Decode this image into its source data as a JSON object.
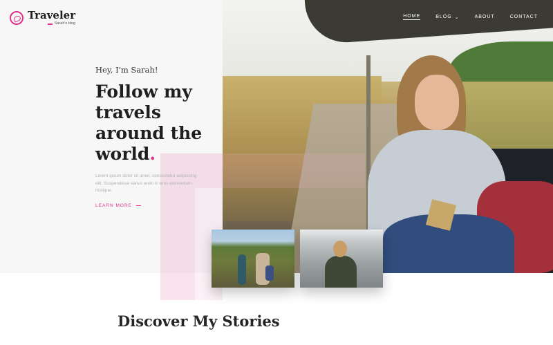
{
  "brand": {
    "title": "Traveler",
    "tagline": "Sarah's blog",
    "accent_color": "#e0318a",
    "icon": "globe-plane-icon"
  },
  "nav": {
    "items": [
      {
        "label": "HOME",
        "active": true
      },
      {
        "label": "BLOG",
        "has_dropdown": true
      },
      {
        "label": "ABOUT"
      },
      {
        "label": "CONTACT"
      }
    ]
  },
  "hero": {
    "greeting": "Hey, I'm Sarah!",
    "headline": "Follow my travels around the world",
    "headline_dot": ".",
    "body": "Lorem ipsum dolor sit amet, consectetur adipiscing elit. Suspendisse varius enim in eros elementum tristique.",
    "cta": "LEARN MORE"
  },
  "section": {
    "title": "Discover My Stories"
  }
}
